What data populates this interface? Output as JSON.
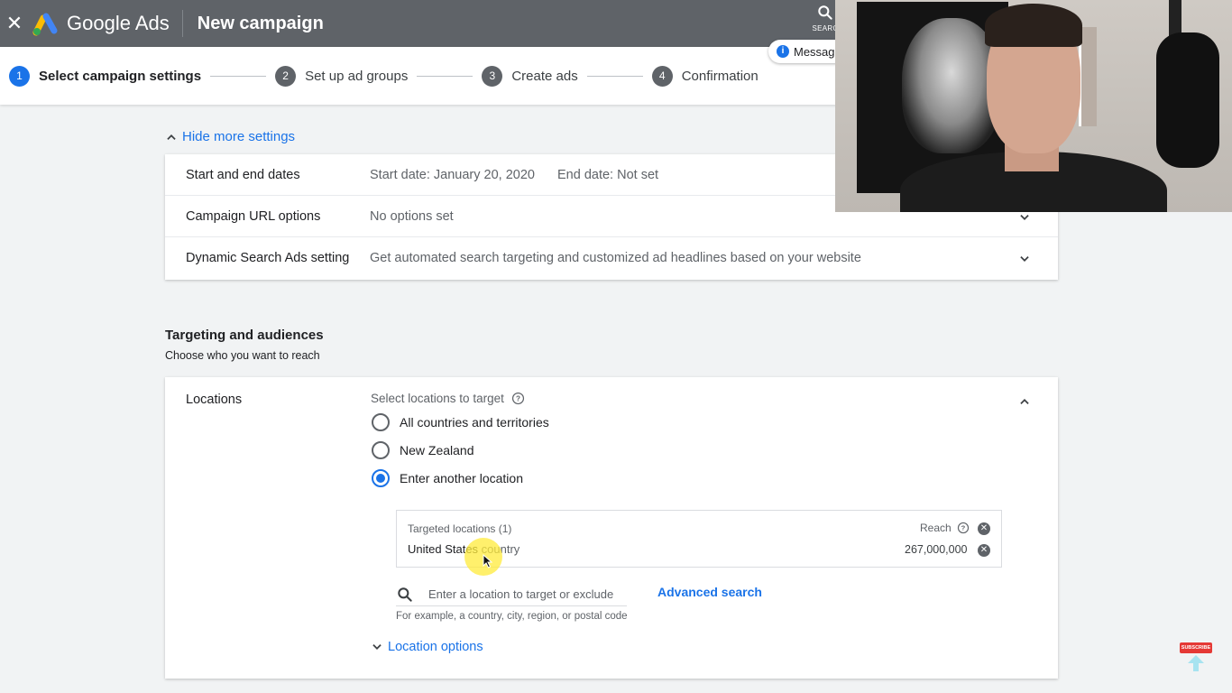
{
  "app": {
    "brand": "Google Ads",
    "page_title": "New campaign",
    "close_icon": "close-icon",
    "search_label": "SEARC",
    "message_chip": "Messag"
  },
  "steps": [
    {
      "num": "1",
      "label": "Select campaign settings",
      "state": "active"
    },
    {
      "num": "2",
      "label": "Set up ad groups",
      "state": "inactive"
    },
    {
      "num": "3",
      "label": "Create ads",
      "state": "inactive"
    },
    {
      "num": "4",
      "label": "Confirmation",
      "state": "inactive"
    }
  ],
  "more_settings": {
    "label": "Hide more settings"
  },
  "settings_rows": [
    {
      "name": "Start and end dates",
      "value": "Start date: January 20, 2020",
      "value2": "End date: Not set"
    },
    {
      "name": "Campaign URL options",
      "value": "No options set"
    },
    {
      "name": "Dynamic Search Ads setting",
      "value": "Get automated search targeting and customized ad headlines based on your website"
    }
  ],
  "targeting": {
    "title": "Targeting and audiences",
    "subtitle": "Choose who you want to reach"
  },
  "locations": {
    "label": "Locations",
    "question": "Select locations to target",
    "options": [
      {
        "label": "All countries and territories",
        "selected": false
      },
      {
        "label": "New Zealand",
        "selected": false
      },
      {
        "label": "Enter another location",
        "selected": true
      }
    ],
    "targeted_header": "Targeted locations (1)",
    "reach_label": "Reach",
    "targeted_name": "United States",
    "targeted_type": "country",
    "targeted_reach": "267,000,000",
    "search_placeholder": "Enter a location to target or exclude",
    "advanced_search": "Advanced search",
    "hint": "For example, a country, city, region, or postal code",
    "location_options": "Location options"
  },
  "subscribe_badge": "SUBSCRIBE",
  "colors": {
    "topbar": "#5f6368",
    "accent": "#1a73e8",
    "background": "#f1f3f4"
  }
}
